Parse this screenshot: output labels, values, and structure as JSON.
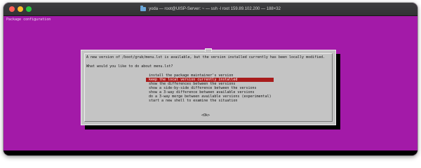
{
  "window": {
    "title": "yoda — root@UISP-Server: ~ — ssh -l root 159.89.102.200 — 188×32",
    "title_icon": "folder-icon",
    "background_color": "#a31aa8",
    "traffic_lights": [
      "close",
      "minimize",
      "zoom"
    ]
  },
  "terminal": {
    "backtitle": "Package configuration"
  },
  "dialog": {
    "message": "A new version of /boot/grub/menu.lst is available, but the version installed currently has been locally modified.",
    "question": "What would you like to do about menu.lst?",
    "options": [
      "install the package maintainer's version",
      "keep the local version currently installed",
      "show the differences between the versions",
      "show a side-by-side difference between the versions",
      "show a 3-way difference between available versions",
      "do a 3-way merge between available versions (experimental)",
      "start a new shell to examine the situation"
    ],
    "selected_index": 1,
    "selected_color": "#a81c1c",
    "ok_label": "<Ok>"
  }
}
